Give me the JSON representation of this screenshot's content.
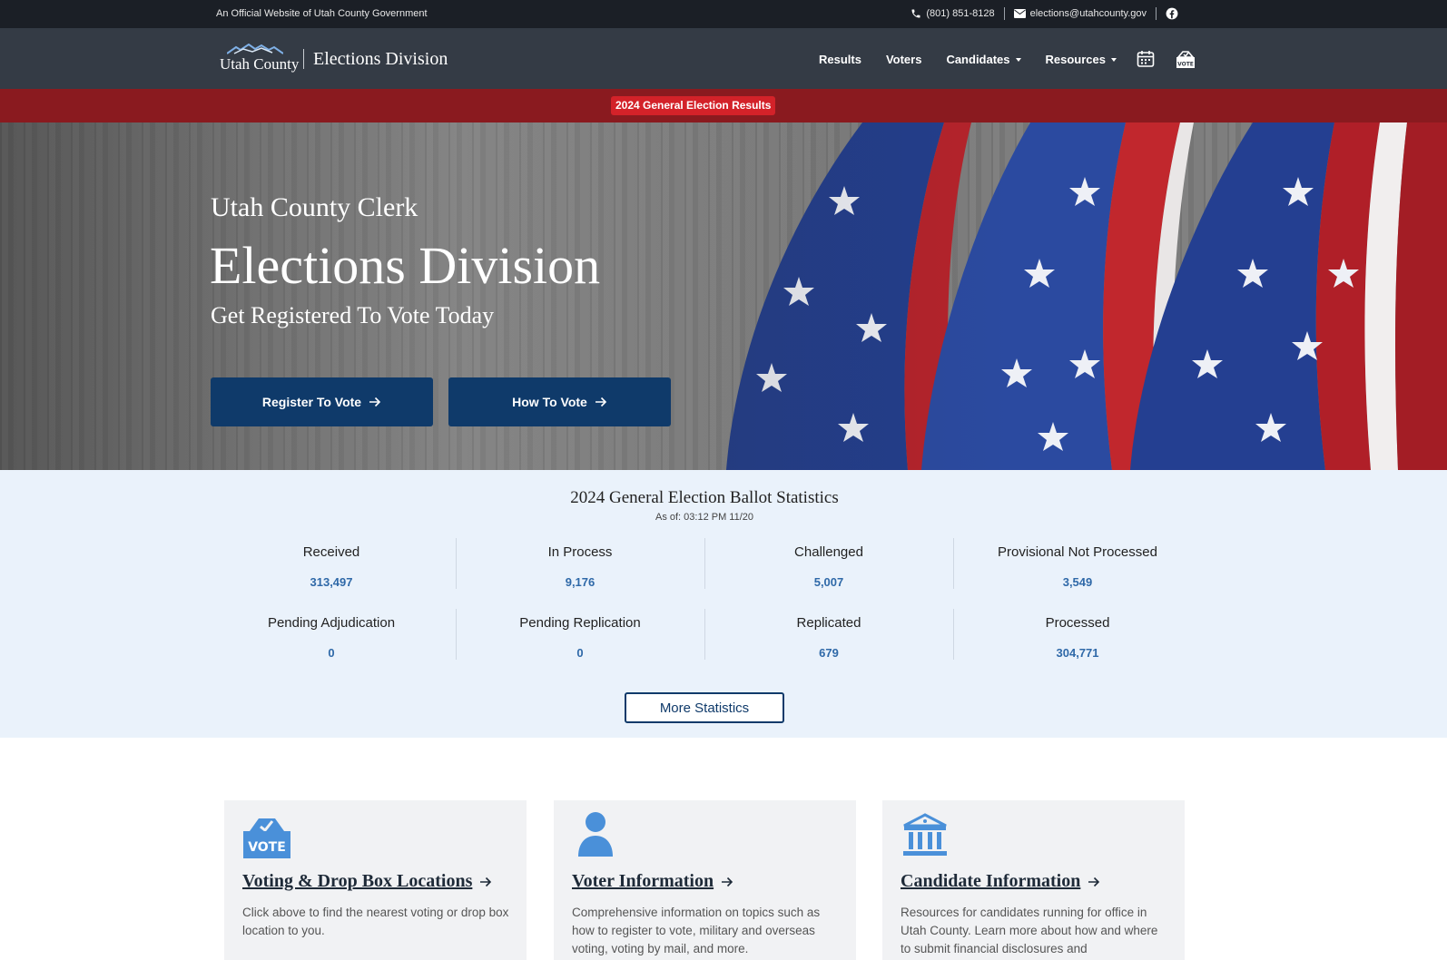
{
  "topbar": {
    "official": "An Official Website of Utah County Government",
    "phone": "(801) 851-8128",
    "email": "elections@utahcounty.gov"
  },
  "nav": {
    "brand_logo_text": "Utah County",
    "brand_division": "Elections Division",
    "links": {
      "results": "Results",
      "voters": "Voters",
      "candidates": "Candidates",
      "resources": "Resources"
    }
  },
  "banner": {
    "results_link": "2024 General Election Results"
  },
  "hero": {
    "kicker": "Utah County Clerk",
    "title": "Elections Division",
    "tagline": "Get Registered To Vote Today",
    "register_button": "Register To Vote",
    "how_button": "How To Vote"
  },
  "stats": {
    "heading": "2024 General Election Ballot Statistics",
    "as_of": "As of: 03:12 PM 11/20",
    "items": [
      {
        "label": "Received",
        "value": "313,497"
      },
      {
        "label": "In Process",
        "value": "9,176"
      },
      {
        "label": "Challenged",
        "value": "5,007"
      },
      {
        "label": "Provisional Not Processed",
        "value": "3,549"
      },
      {
        "label": "Pending Adjudication",
        "value": "0"
      },
      {
        "label": "Pending Replication",
        "value": "0"
      },
      {
        "label": "Replicated",
        "value": "679"
      },
      {
        "label": "Processed",
        "value": "304,771"
      }
    ],
    "more_button": "More Statistics"
  },
  "cards": [
    {
      "icon": "vote-box-icon",
      "icon_text": "VOTE",
      "title": "Voting & Drop Box Locations",
      "description": "Click above to find the nearest voting or drop box location to you."
    },
    {
      "icon": "person-icon",
      "title": "Voter Information",
      "description": "Comprehensive information on topics such as how to register to vote, military and overseas voting, voting by mail, and more."
    },
    {
      "icon": "government-building-icon",
      "title": "Candidate Information",
      "description": "Resources for candidates running for office in Utah County. Learn more about how and where to submit financial disclosures and"
    }
  ],
  "colors": {
    "topbar": "#1b1f26",
    "navbar": "#343b45",
    "banner": "#8a1a1f",
    "banner_pill": "#d32229",
    "primary_button": "#0f3a6a",
    "stats_bg": "#eaf2fb",
    "stat_value": "#2f69a8",
    "card_icon": "#4a90d9"
  }
}
